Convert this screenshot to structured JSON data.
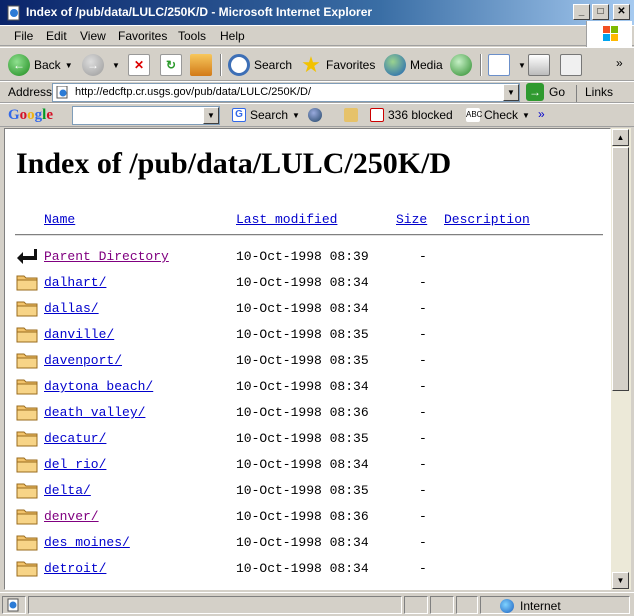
{
  "window": {
    "title": "Index of /pub/data/LULC/250K/D - Microsoft Internet Explorer",
    "minimize_label": "_",
    "maximize_label": "□",
    "close_label": "✕"
  },
  "menu": [
    "File",
    "Edit",
    "View",
    "Favorites",
    "Tools",
    "Help"
  ],
  "toolbar": {
    "back_label": "Back",
    "search_label": "Search",
    "favorites_label": "Favorites",
    "media_label": "Media"
  },
  "address": {
    "label": "Address",
    "url": "http://edcftp.cr.usgs.gov/pub/data/LULC/250K/D/",
    "go_label": "Go",
    "links_label": "Links"
  },
  "google_bar": {
    "logo": "Google",
    "search_label": "Search",
    "blocked_label": "336 blocked",
    "check_label": "Check",
    "more_label": "»"
  },
  "page": {
    "heading": "Index of /pub/data/LULC/250K/D",
    "columns": {
      "name": "Name",
      "last_modified": "Last modified",
      "size": "Size",
      "description": "Description"
    },
    "rows": [
      {
        "name": "Parent Directory",
        "date": "10-Oct-1998 08:39",
        "size": "-",
        "visited": true,
        "parent": true
      },
      {
        "name": "dalhart/",
        "date": "10-Oct-1998 08:34",
        "size": "-",
        "visited": false
      },
      {
        "name": "dallas/",
        "date": "10-Oct-1998 08:34",
        "size": "-",
        "visited": false
      },
      {
        "name": "danville/",
        "date": "10-Oct-1998 08:35",
        "size": "-",
        "visited": false
      },
      {
        "name": "davenport/",
        "date": "10-Oct-1998 08:35",
        "size": "-",
        "visited": false
      },
      {
        "name": "daytona_beach/",
        "date": "10-Oct-1998 08:34",
        "size": "-",
        "visited": false
      },
      {
        "name": "death_valley/",
        "date": "10-Oct-1998 08:36",
        "size": "-",
        "visited": false
      },
      {
        "name": "decatur/",
        "date": "10-Oct-1998 08:35",
        "size": "-",
        "visited": false
      },
      {
        "name": "del_rio/",
        "date": "10-Oct-1998 08:34",
        "size": "-",
        "visited": false
      },
      {
        "name": "delta/",
        "date": "10-Oct-1998 08:35",
        "size": "-",
        "visited": false
      },
      {
        "name": "denver/",
        "date": "10-Oct-1998 08:36",
        "size": "-",
        "visited": true
      },
      {
        "name": "des_moines/",
        "date": "10-Oct-1998 08:34",
        "size": "-",
        "visited": false
      },
      {
        "name": "detroit/",
        "date": "10-Oct-1998 08:34",
        "size": "-",
        "visited": false
      }
    ]
  },
  "status": {
    "zone_label": "Internet"
  },
  "colors": {
    "link": "#0000cc",
    "visited_link": "#800080",
    "titlebar": "#0a246a",
    "chrome": "#d4d0c8"
  }
}
